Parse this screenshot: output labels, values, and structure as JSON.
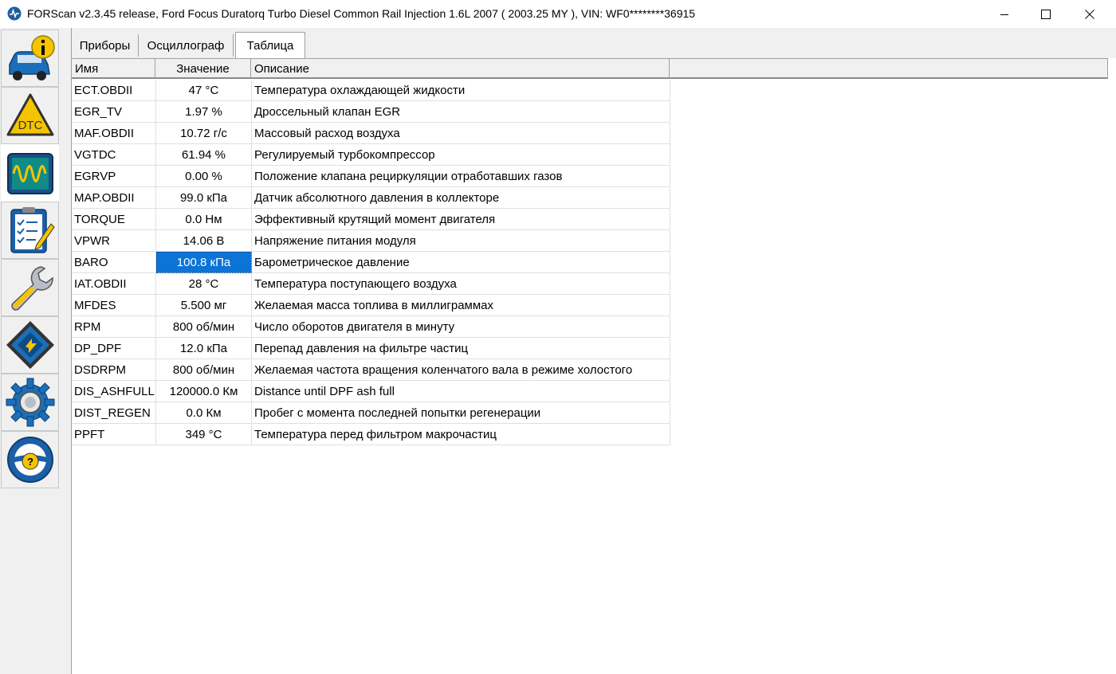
{
  "window": {
    "title": "FORScan v2.3.45 release, Ford Focus Duratorq Turbo Diesel Common Rail Injection 1.6L 2007 ( 2003.25 MY ), VIN: WF0********36915",
    "controls": [
      "minimize-icon",
      "maximize-icon",
      "close-icon"
    ]
  },
  "sidebar": {
    "items": [
      {
        "name": "vehicle-info",
        "icon": "car-info-icon"
      },
      {
        "name": "dtc",
        "icon": "dtc-warning-icon",
        "icon_text": "DTC"
      },
      {
        "name": "oscilloscope",
        "icon": "oscilloscope-icon",
        "active": true
      },
      {
        "name": "tests",
        "icon": "checklist-icon"
      },
      {
        "name": "service",
        "icon": "wrench-icon"
      },
      {
        "name": "configuration",
        "icon": "chip-icon"
      },
      {
        "name": "settings",
        "icon": "gear-icon"
      },
      {
        "name": "help",
        "icon": "steering-help-icon",
        "icon_text": "?"
      }
    ]
  },
  "tabs": [
    {
      "label": "Приборы"
    },
    {
      "label": "Осциллограф"
    },
    {
      "label": "Таблица",
      "active": true
    }
  ],
  "table": {
    "headers": {
      "name": "Имя",
      "value": "Значение",
      "description": "Описание"
    },
    "rows": [
      {
        "name": "ECT.OBDII",
        "value": "47 °C",
        "description": "Температура охлаждающей жидкости"
      },
      {
        "name": "EGR_TV",
        "value": "1.97 %",
        "description": "Дроссельный клапан EGR"
      },
      {
        "name": "MAF.OBDII",
        "value": "10.72 г/с",
        "description": "Массовый расход воздуха"
      },
      {
        "name": "VGTDC",
        "value": "61.94 %",
        "description": "Регулируемый турбокомпрессор"
      },
      {
        "name": "EGRVP",
        "value": "0.00 %",
        "description": "Положение клапана рециркуляции отработавших газов"
      },
      {
        "name": "MAP.OBDII",
        "value": "99.0 кПа",
        "description": "Датчик абсолютного давления в коллекторе"
      },
      {
        "name": "TORQUE",
        "value": "0.0 Нм",
        "description": "Эффективный крутящий момент двигателя"
      },
      {
        "name": "VPWR",
        "value": "14.06 В",
        "description": "Напряжение питания модуля"
      },
      {
        "name": "BARO",
        "value": "100.8 кПа",
        "description": "Барометрическое давление",
        "selected": true
      },
      {
        "name": "IAT.OBDII",
        "value": "28 °C",
        "description": "Температура поступающего воздуха"
      },
      {
        "name": "MFDES",
        "value": "5.500 мг",
        "description": "Желаемая масса топлива в миллиграммах"
      },
      {
        "name": "RPM",
        "value": "800 об/мин",
        "description": "Число оборотов двигателя в минуту"
      },
      {
        "name": "DP_DPF",
        "value": "12.0 кПа",
        "description": "Перепад давления на фильтре частиц"
      },
      {
        "name": "DSDRPM",
        "value": "800 об/мин",
        "description": "Желаемая частота вращения коленчатого вала в режиме холостого"
      },
      {
        "name": "DIS_ASHFULL",
        "value": "120000.0 Км",
        "description": "Distance until DPF ash full"
      },
      {
        "name": "DIST_REGEN",
        "value": "0.0 Км",
        "description": "Пробег с момента последней попытки регенерации"
      },
      {
        "name": "PPFT",
        "value": "349 °C",
        "description": "Температура перед фильтром макрочастиц"
      }
    ]
  },
  "colors": {
    "selection": "#0b74d6",
    "toolbar_bg": "#f0f0f0",
    "accent_blue": "#1b5fa8",
    "accent_yellow": "#f5c400"
  }
}
